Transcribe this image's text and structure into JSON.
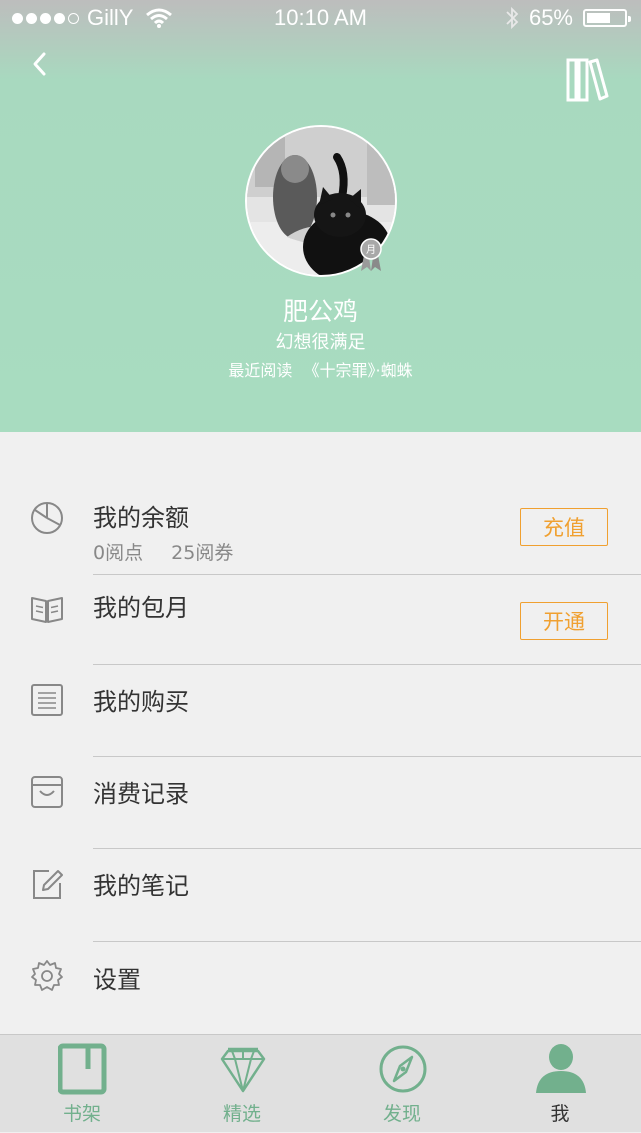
{
  "status_bar": {
    "carrier": "GillY",
    "time": "10:10 AM",
    "battery": "65%",
    "battery_level": 0.65
  },
  "header": {
    "back_icon": "chevron-left-icon",
    "bookshelf_icon": "bookshelf-icon",
    "accent_color": "#a8dcc0"
  },
  "profile": {
    "name": "肥公鸡",
    "motto": "幻想很满足",
    "recent_label": "最近阅读",
    "recent_book": "《十宗罪》·蜘蛛",
    "badge_text": "月"
  },
  "menu": {
    "balance": {
      "label": "我的余额",
      "points": "0阅点",
      "coupons": "25阅券",
      "action": "充值",
      "icon": "pie-chart-icon"
    },
    "monthly": {
      "label": "我的包月",
      "action": "开通",
      "icon": "open-book-icon"
    },
    "purchases": {
      "label": "我的购买",
      "icon": "list-icon"
    },
    "records": {
      "label": "消费记录",
      "icon": "inbox-icon"
    },
    "notes": {
      "label": "我的笔记",
      "icon": "edit-icon"
    },
    "settings": {
      "label": "设置",
      "icon": "gear-icon"
    }
  },
  "tabbar": {
    "tabs": [
      {
        "label": "书架",
        "icon": "bookshelf-tab-icon",
        "color": "#72b08d"
      },
      {
        "label": "精选",
        "icon": "diamond-icon",
        "color": "#72b08d"
      },
      {
        "label": "发现",
        "icon": "compass-icon",
        "color": "#72b08d"
      },
      {
        "label": "我",
        "icon": "user-icon",
        "color": "#333333",
        "active": true
      }
    ]
  },
  "colors": {
    "action": "#f0a030",
    "tab_green": "#72b08d"
  }
}
